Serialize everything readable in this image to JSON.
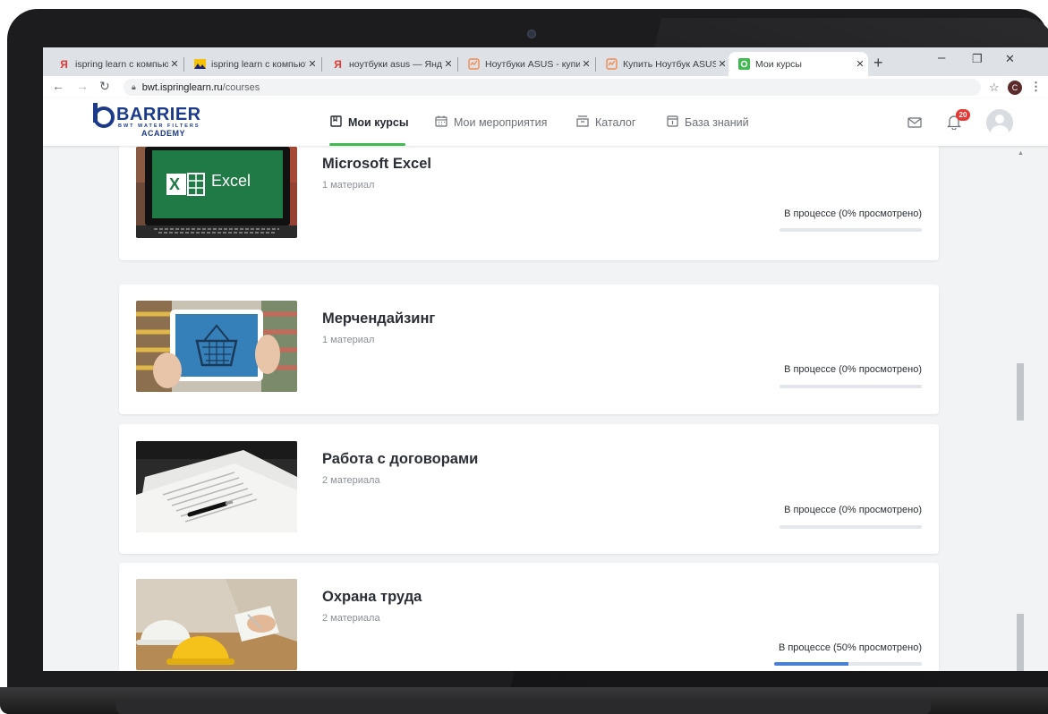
{
  "browser": {
    "tabs": [
      {
        "label": "ispring learn с компьют",
        "icon": "yandex-icon",
        "active": false
      },
      {
        "label": "ispring learn с компьют",
        "icon": "yandex-images-icon",
        "active": false
      },
      {
        "label": "ноутбуки asus — Янде",
        "icon": "yandex-icon",
        "active": false
      },
      {
        "label": "Ноутбуки ASUS - купит",
        "icon": "store-icon",
        "active": false
      },
      {
        "label": "Купить Ноутбук ASUS",
        "icon": "store-icon",
        "active": false
      },
      {
        "label": "Мои курсы",
        "icon": "ispring-icon",
        "active": true
      }
    ],
    "new_tab": "+",
    "url_host": "bwt.ispringlearn.ru",
    "url_path": "/courses",
    "profile_initial": "C"
  },
  "header": {
    "logo_brand": "BARRIER",
    "logo_sub": "BWT WATER FILTERS",
    "logo_academy": "ACADEMY",
    "nav": [
      {
        "label": "Мои курсы",
        "icon": "book-icon",
        "active": true
      },
      {
        "label": "Мои мероприятия",
        "icon": "calendar-icon",
        "active": false
      },
      {
        "label": "Каталог",
        "icon": "catalog-icon",
        "active": false
      },
      {
        "label": "База знаний",
        "icon": "knowledge-icon",
        "active": false
      }
    ],
    "notification_count": "20"
  },
  "courses": [
    {
      "title": "Microsoft Excel",
      "materials": "1 материал",
      "status": "В процессе (0% просмотрено)",
      "progress": 0
    },
    {
      "title": "Мерчендайзинг",
      "materials": "1 материал",
      "status": "В процессе (0% просмотрено)",
      "progress": 0
    },
    {
      "title": "Работа с договорами",
      "materials": "2 материала",
      "status": "В процессе (0% просмотрено)",
      "progress": 0
    },
    {
      "title": "Охрана труда",
      "materials": "2 материала",
      "status": "В процессе (50% просмотрено)",
      "progress": 50
    }
  ],
  "thumbs": {
    "excel_text": "Excel"
  },
  "colors": {
    "accent_green": "#3fb950",
    "progress_blue": "#4a7fd6",
    "brand_blue": "#1b3a8a",
    "badge_red": "#e53935"
  }
}
